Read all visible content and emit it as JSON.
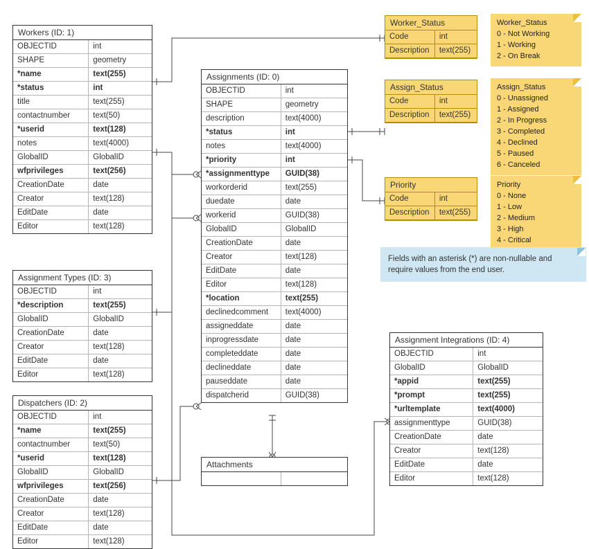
{
  "entities": {
    "workers": {
      "title": "Workers (ID: 1)",
      "rows": [
        {
          "n": "OBJECTID",
          "t": "int"
        },
        {
          "n": "SHAPE",
          "t": "geometry"
        },
        {
          "n": "*name",
          "t": "text(255)",
          "b": true
        },
        {
          "n": "*status",
          "t": "int",
          "b": true
        },
        {
          "n": "title",
          "t": "text(255)"
        },
        {
          "n": "contactnumber",
          "t": "text(50)"
        },
        {
          "n": "*userid",
          "t": "text(128)",
          "b": true
        },
        {
          "n": "notes",
          "t": "text(4000)"
        },
        {
          "n": "GlobalID",
          "t": "GlobalID"
        },
        {
          "n": "wfprivileges",
          "t": "text(256)",
          "b": true
        },
        {
          "n": "CreationDate",
          "t": "date"
        },
        {
          "n": "Creator",
          "t": "text(128)"
        },
        {
          "n": "EditDate",
          "t": "date"
        },
        {
          "n": "Editor",
          "t": "text(128)"
        }
      ]
    },
    "assignmentTypes": {
      "title": "Assignment Types (ID: 3)",
      "rows": [
        {
          "n": "OBJECTID",
          "t": "int"
        },
        {
          "n": "*description",
          "t": "text(255)",
          "b": true
        },
        {
          "n": "GlobalID",
          "t": "GlobalID"
        },
        {
          "n": "CreationDate",
          "t": "date"
        },
        {
          "n": "Creator",
          "t": "text(128)"
        },
        {
          "n": "EditDate",
          "t": "date"
        },
        {
          "n": "Editor",
          "t": "text(128)"
        }
      ]
    },
    "dispatchers": {
      "title": "Dispatchers (ID: 2)",
      "rows": [
        {
          "n": "OBJECTID",
          "t": "int"
        },
        {
          "n": "*name",
          "t": "text(255)",
          "b": true
        },
        {
          "n": "contactnumber",
          "t": "text(50)"
        },
        {
          "n": "*userid",
          "t": "text(128)",
          "b": true
        },
        {
          "n": "GlobalID",
          "t": "GlobalID"
        },
        {
          "n": "wfprivileges",
          "t": "text(256)",
          "b": true
        },
        {
          "n": "CreationDate",
          "t": "date"
        },
        {
          "n": "Creator",
          "t": "text(128)"
        },
        {
          "n": "EditDate",
          "t": "date"
        },
        {
          "n": "Editor",
          "t": "text(128)"
        }
      ]
    },
    "assignments": {
      "title": "Assignments (ID: 0)",
      "rows": [
        {
          "n": "OBJECTID",
          "t": "int"
        },
        {
          "n": "SHAPE",
          "t": "geometry"
        },
        {
          "n": "description",
          "t": "text(4000)"
        },
        {
          "n": "*status",
          "t": "int",
          "b": true
        },
        {
          "n": "notes",
          "t": "text(4000)"
        },
        {
          "n": "*priority",
          "t": "int",
          "b": true
        },
        {
          "n": "*assignmenttype",
          "t": "GUID(38)",
          "b": true
        },
        {
          "n": "workorderid",
          "t": "text(255)"
        },
        {
          "n": "duedate",
          "t": "date"
        },
        {
          "n": "workerid",
          "t": "GUID(38)"
        },
        {
          "n": "GlobalID",
          "t": "GlobalID"
        },
        {
          "n": "CreationDate",
          "t": "date"
        },
        {
          "n": "Creator",
          "t": "text(128)"
        },
        {
          "n": "EditDate",
          "t": "date"
        },
        {
          "n": "Editor",
          "t": "text(128)"
        },
        {
          "n": "*location",
          "t": "text(255)",
          "b": true
        },
        {
          "n": "declinedcomment",
          "t": "text(4000)"
        },
        {
          "n": "assigneddate",
          "t": "date"
        },
        {
          "n": "inprogressdate",
          "t": "date"
        },
        {
          "n": "completeddate",
          "t": "date"
        },
        {
          "n": "declineddate",
          "t": "date"
        },
        {
          "n": "pauseddate",
          "t": "date"
        },
        {
          "n": "dispatcherid",
          "t": "GUID(38)"
        }
      ]
    },
    "attachments": {
      "title": "Attachments",
      "rows": [
        {
          "n": "",
          "t": ""
        }
      ]
    },
    "integrations": {
      "title": "Assignment Integrations (ID: 4)",
      "rows": [
        {
          "n": "OBJECTID",
          "t": "int"
        },
        {
          "n": "GlobalID",
          "t": "GlobalID"
        },
        {
          "n": "*appid",
          "t": "text(255)",
          "b": true
        },
        {
          "n": "*prompt",
          "t": "text(255)",
          "b": true
        },
        {
          "n": "*urltemplate",
          "t": "text(4000)",
          "b": true
        },
        {
          "n": "assignmenttype",
          "t": "GUID(38)"
        },
        {
          "n": "CreationDate",
          "t": "date"
        },
        {
          "n": "Creator",
          "t": "text(128)"
        },
        {
          "n": "EditDate",
          "t": "date"
        },
        {
          "n": "Editor",
          "t": "text(128)"
        }
      ]
    }
  },
  "lookups": {
    "workerStatus": {
      "title": "Worker_Status",
      "rows": [
        {
          "n": "Code",
          "t": "int"
        },
        {
          "n": "Description",
          "t": "text(255)"
        }
      ]
    },
    "assignStatus": {
      "title": "Assign_Status",
      "rows": [
        {
          "n": "Code",
          "t": "int"
        },
        {
          "n": "Description",
          "t": "text(255)"
        }
      ]
    },
    "priority": {
      "title": "Priority",
      "rows": [
        {
          "n": "Code",
          "t": "int"
        },
        {
          "n": "Description",
          "t": "text(255)"
        }
      ]
    }
  },
  "notes": {
    "workerStatus": "Worker_Status\n0 - Not Working\n1 - Working\n2 - On Break",
    "assignStatus": "Assign_Status\n0 - Unassigned\n1 - Assigned\n2 - In Progress\n3 - Completed\n4 - Declined\n5 - Paused\n6 - Canceled",
    "priority": "Priority\n0 - None\n1 - Low\n2 - Medium\n3 - High\n4 - Critical",
    "hint": "Fields with an asterisk (*) are non-nullable and require values from the end user."
  }
}
